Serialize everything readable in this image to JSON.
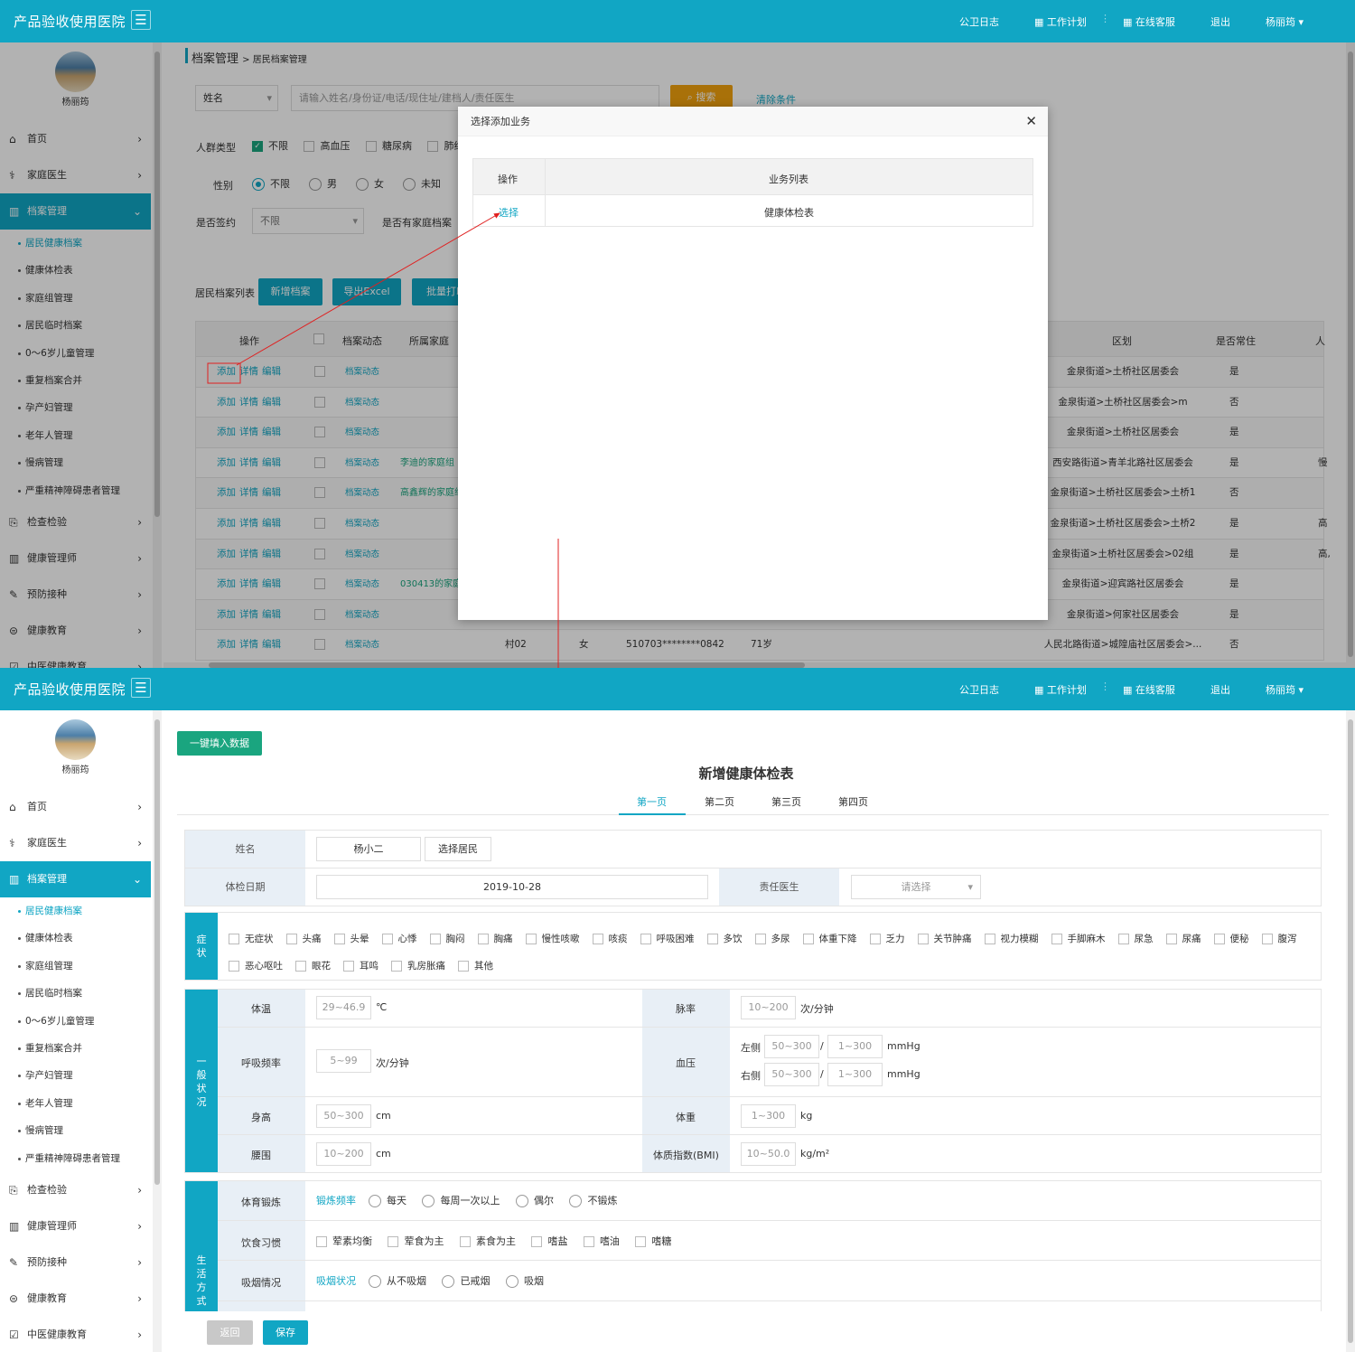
{
  "header": {
    "brand": "产品验收使用医院",
    "links": [
      "公卫日志",
      "工作计划",
      "在线客服",
      "退出",
      "杨丽筠"
    ]
  },
  "user": {
    "name": "杨丽筠"
  },
  "nav": {
    "top": [
      {
        "label": "首页"
      },
      {
        "label": "家庭医生"
      }
    ],
    "active": "档案管理",
    "subs": [
      "居民健康档案",
      "健康体检表",
      "家庭组管理",
      "居民临时档案",
      "0～6岁儿童管理",
      "重复档案合并",
      "孕产妇管理",
      "老年人管理",
      "慢病管理",
      "严重精神障碍患者管理"
    ],
    "bottom": [
      "检查检验",
      "健康管理师",
      "预防接种",
      "健康教育",
      "中医健康教育"
    ]
  },
  "breadcrumb": {
    "main": "档案管理",
    "sub": "居民档案管理"
  },
  "search": {
    "field": "姓名",
    "placeholder": "请输入姓名/身份证/电话/现住址/建档人/责任医生",
    "search_btn": "搜索",
    "clear": "清除条件"
  },
  "filters": {
    "crowd_label": "人群类型",
    "crowd": [
      "不限",
      "高血压",
      "糖尿病",
      "肺结"
    ],
    "sex_label": "性别",
    "sex": [
      "不限",
      "男",
      "女",
      "未知"
    ],
    "sign_label": "是否签约",
    "sign_value": "不限",
    "family_label": "是否有家庭档案"
  },
  "list": {
    "title": "居民档案列表",
    "new_btn": "新增档案",
    "export_btn": "导出Excel",
    "batch_btn": "批量打印",
    "headers": [
      "操作",
      "档案动态",
      "所属家庭",
      "区划",
      "是否常住",
      "人"
    ],
    "ops": [
      "添加",
      "详情",
      "编辑"
    ],
    "dyn": "档案动态",
    "rows": [
      {
        "family": "",
        "region": "金泉街道>土桥社区居委会",
        "resident": "是",
        "extra": ""
      },
      {
        "family": "",
        "region": "金泉街道>土桥社区居委会>m",
        "resident": "否",
        "extra": ""
      },
      {
        "family": "",
        "region": "金泉街道>土桥社区居委会",
        "resident": "是",
        "extra": ""
      },
      {
        "family": "李迪的家庭组",
        "region": "西安路街道>青羊北路社区居委会",
        "resident": "是",
        "extra": "慢"
      },
      {
        "family": "高鑫辉的家庭组",
        "region": "金泉街道>土桥社区居委会>土桥1",
        "resident": "否",
        "extra": ""
      },
      {
        "family": "",
        "region": "金泉街道>土桥社区居委会>土桥2",
        "resident": "是",
        "extra": "高"
      },
      {
        "family": "",
        "region": "金泉街道>土桥社区居委会>02组",
        "resident": "是",
        "extra": "高,"
      },
      {
        "family": "030413的家庭组",
        "region": "金泉街道>迎宾路社区居委会",
        "resident": "是",
        "extra": ""
      },
      {
        "family": "",
        "region": "金泉街道>何家社区居委会",
        "resident": "是",
        "extra": ""
      },
      {
        "family": "",
        "region": "人民北路街道>城隍庙社区居委会>...",
        "resident": "否",
        "extra": "",
        "c1": "村02",
        "c2": "女",
        "c3": "510703********0842",
        "c4": "71岁"
      }
    ]
  },
  "modal": {
    "title": "选择添加业务",
    "col1": "操作",
    "col2": "业务列表",
    "action": "选择",
    "item": "健康体检表"
  },
  "form": {
    "fill_btn": "一键填入数据",
    "title": "新增健康体检表",
    "tabs": [
      "第一页",
      "第二页",
      "第三页",
      "第四页"
    ],
    "name_label": "姓名",
    "name_value": "杨小二",
    "pick_btn": "选择居民",
    "date_label": "体检日期",
    "date_value": "2019-10-28",
    "doctor_label": "责任医生",
    "doctor_ph": "请选择",
    "sym_label": "症状",
    "symptoms": [
      "无症状",
      "头痛",
      "头晕",
      "心悸",
      "胸闷",
      "胸痛",
      "慢性咳嗽",
      "咳痰",
      "呼吸困难",
      "多饮",
      "多尿",
      "体重下降",
      "乏力",
      "关节肿痛",
      "视力模糊",
      "手脚麻木",
      "尿急",
      "尿痛",
      "便秘",
      "腹泻",
      "恶心呕吐",
      "眼花",
      "耳鸣",
      "乳房胀痛",
      "其他"
    ],
    "general_label": "一般状况",
    "temp": {
      "label": "体温",
      "ph": "29~46.9",
      "unit": "℃"
    },
    "pulse": {
      "label": "脉率",
      "ph": "10~200",
      "unit": "次/分钟"
    },
    "resp": {
      "label": "呼吸频率",
      "ph": "5~99",
      "unit": "次/分钟"
    },
    "bp": {
      "label": "血压",
      "left": "左侧",
      "right": "右侧",
      "ph1": "50~300",
      "ph2": "1~300",
      "unit": "mmHg"
    },
    "height": {
      "label": "身高",
      "ph": "50~300",
      "unit": "cm"
    },
    "weight": {
      "label": "体重",
      "ph": "1~300",
      "unit": "kg"
    },
    "waist": {
      "label": "腰围",
      "ph": "10~200",
      "unit": "cm"
    },
    "bmi": {
      "label": "体质指数(BMI)",
      "ph": "10~50.0",
      "unit": "kg/m²"
    },
    "life_label": "生活方式",
    "exercise": {
      "label": "体育锻炼",
      "sub": "锻炼频率",
      "opts": [
        "每天",
        "每周一次以上",
        "偶尔",
        "不锻炼"
      ]
    },
    "diet": {
      "label": "饮食习惯",
      "opts": [
        "荤素均衡",
        "荤食为主",
        "素食为主",
        "嗜盐",
        "嗜油",
        "嗜糖"
      ]
    },
    "smoke": {
      "label": "吸烟情况",
      "sub": "吸烟状况",
      "opts": [
        "从不吸烟",
        "已戒烟",
        "吸烟"
      ]
    },
    "back_btn": "返回",
    "save_btn": "保存"
  },
  "colors": {
    "primary": "#11a6c4",
    "orange": "#f2a20d",
    "green": "#1aa57f",
    "arrow": "#e02020"
  }
}
